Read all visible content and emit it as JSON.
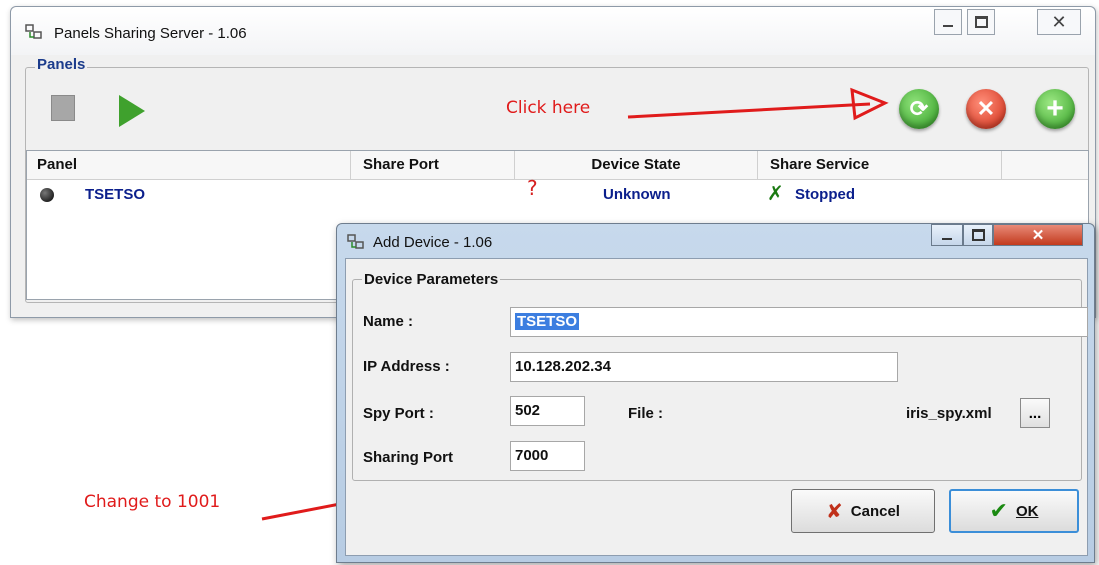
{
  "main_window": {
    "title": "Panels Sharing Server  - 1.06",
    "group_label": "Panels",
    "columns": [
      "Panel",
      "Share Port",
      "Device State",
      "Share Service"
    ],
    "rows": [
      {
        "panel": "TSETSO",
        "share_port": "",
        "device_state_icon": "question-icon",
        "device_state": "Unknown",
        "share_service_icon": "stopped-icon",
        "share_service": "Stopped"
      }
    ],
    "toolbar": {
      "stop": "stop-icon",
      "start": "play-icon",
      "refresh": "refresh-icon",
      "remove": "remove-icon",
      "add": "add-icon"
    }
  },
  "annotations": {
    "click_here": "Click here",
    "change_to": "Change to 1001",
    "color": "#e01b1b"
  },
  "dialog": {
    "title": "Add Device  - 1.06",
    "group_label": "Device Parameters",
    "name_label": "Name :",
    "name_value": "TSETSO",
    "ip_label": "IP Address :",
    "ip_value": "10.128.202.34",
    "spy_port_label": "Spy Port :",
    "spy_port_value": "502",
    "file_label": "File :",
    "file_value": "iris_spy.xml",
    "browse_label": "...",
    "sharing_port_label": "Sharing Port",
    "sharing_port_value": "7000",
    "cancel_label": "Cancel",
    "ok_label": "OK"
  },
  "colors": {
    "accent_blue": "#1c3c8c",
    "row_text": "#0b1f8c",
    "selection": "#3c7ee0",
    "green": "#3fa12d",
    "red": "#cf2a14"
  }
}
